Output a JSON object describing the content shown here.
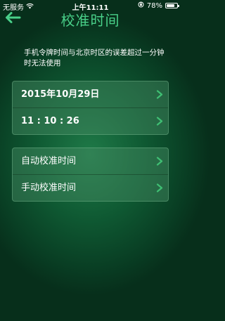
{
  "status_bar": {
    "carrier": "无服务",
    "time": "上午11:11",
    "battery_percent": "78%",
    "battery_level": 0.78
  },
  "header": {
    "title": "校准时间"
  },
  "notice": "手机令牌时间与北京时区的误差超过一分钟时无法使用",
  "datetime_card": {
    "date": "2015年10月29日",
    "time": "11 : 10 : 26"
  },
  "calibration_card": {
    "auto_label": "自动校准时间",
    "manual_label": "手动校准时间"
  },
  "colors": {
    "accent": "#49d089",
    "background": "#0f5a33",
    "chevron": "#3fbf73"
  }
}
